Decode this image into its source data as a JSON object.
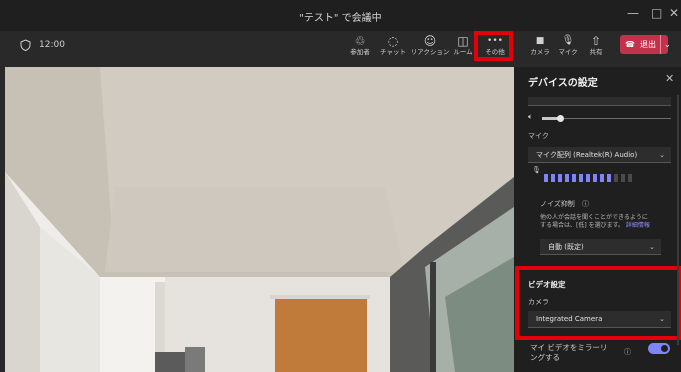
{
  "window": {
    "title": "\"テスト\" で会議中",
    "minimize": "—",
    "maximize": "□",
    "close": "✕"
  },
  "toolbar": {
    "timer": "12:00",
    "buttons": [
      {
        "icon": "participants-icon",
        "glyph": "♲",
        "label": "参加者"
      },
      {
        "icon": "chat-icon",
        "glyph": "◌",
        "label": "チャット"
      },
      {
        "icon": "reaction-icon",
        "glyph": "☺",
        "label": "リアクション"
      },
      {
        "icon": "room-icon",
        "glyph": "◫",
        "label": "ルーム"
      },
      {
        "icon": "more-icon",
        "glyph": "•••",
        "label": "その他"
      },
      {
        "icon": "camera-icon",
        "glyph": "■",
        "label": "カメラ"
      },
      {
        "icon": "mic-icon",
        "glyph": "🎙",
        "label": "マイク"
      },
      {
        "icon": "share-icon",
        "glyph": "⇧",
        "label": "共有"
      }
    ],
    "leave_label": "退出"
  },
  "panel": {
    "title": "デバイスの設定",
    "mic_label": "マイク",
    "mic_device": "マイク配列 (Realtek(R) Audio)",
    "noise_label": "ノイズ抑制",
    "noise_desc_1": "他の人が会話を聞くことができるように",
    "noise_desc_2": "する場合は、[低] を選びます。",
    "noise_link": "詳細情報",
    "noise_value": "自動 (既定)",
    "video_heading": "ビデオ設定",
    "camera_label": "カメラ",
    "camera_device": "Integrated Camera",
    "mirror_label_1": "マイ ビデオをミラーリ",
    "mirror_label_2": "ングする",
    "mirror_on": true,
    "mic_level_active_bars": 10
  },
  "colors": {
    "highlight": "#e4000b",
    "accent": "#7f85f5",
    "leave": "#c4314b"
  }
}
